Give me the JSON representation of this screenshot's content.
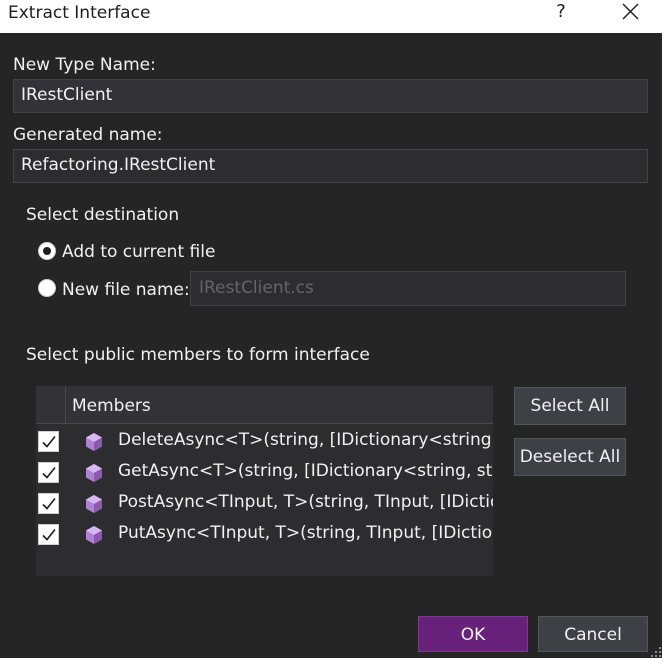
{
  "window": {
    "title": "Extract Interface",
    "help_glyph": "?"
  },
  "form": {
    "type_name_label": "New Type Name:",
    "type_name_value": "IRestClient",
    "generated_name_label": "Generated name:",
    "generated_name_value": "Refactoring.IRestClient"
  },
  "destination": {
    "group_label": "Select destination",
    "option_current": "Add to current file",
    "option_new": "New file name:",
    "selected": "current",
    "new_file_placeholder": "IRestClient.cs"
  },
  "members": {
    "section_label": "Select public members to form interface",
    "column_header": "Members",
    "items": [
      {
        "text": "DeleteAsync<T>(string, [IDictionary<string, str",
        "checked": true
      },
      {
        "text": "GetAsync<T>(string, [IDictionary<string, string",
        "checked": true
      },
      {
        "text": "PostAsync<TInput, T>(string, TInput, [IDictiona",
        "checked": true
      },
      {
        "text": "PutAsync<TInput, T>(string, TInput, [IDictionar",
        "checked": true
      }
    ],
    "select_all_label": "Select All",
    "deselect_all_label": "Deselect All"
  },
  "footer": {
    "ok_label": "OK",
    "cancel_label": "Cancel"
  },
  "colors": {
    "dialog_bg": "#252526",
    "ok_accent": "#68217a",
    "member_icon": "#b180d7"
  }
}
